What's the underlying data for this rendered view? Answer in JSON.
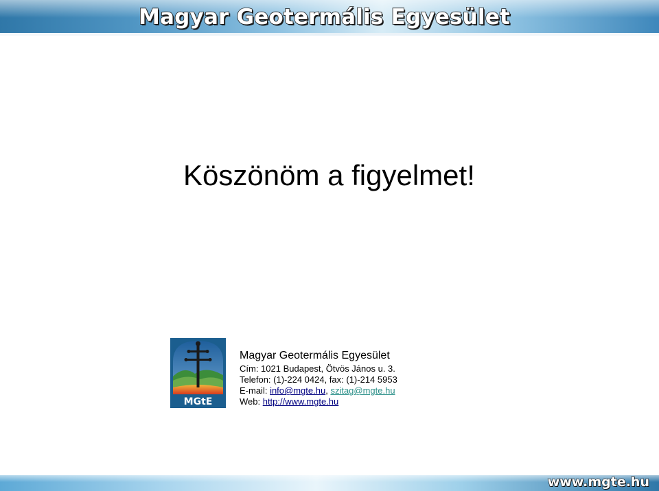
{
  "banner": {
    "title": "Magyar Geotermális Egyesület"
  },
  "slide": {
    "thanks": "Köszönöm a figyelmet!"
  },
  "logo": {
    "text": "MGtE"
  },
  "contact": {
    "org": "Magyar Geotermális Egyesület",
    "address": "Cím: 1021 Budapest, Ötvös János u. 3.",
    "phone": "Telefon: (1)-224 0424, fax: (1)-214 5953",
    "email_label": "E-mail: ",
    "email1": "info@mgte.hu",
    "email_sep": ", ",
    "email2": "szitag@mgte.hu",
    "web_label": "Web: ",
    "web": "http://www.mgte.hu"
  },
  "footer": {
    "site": "www.mgte.hu"
  }
}
